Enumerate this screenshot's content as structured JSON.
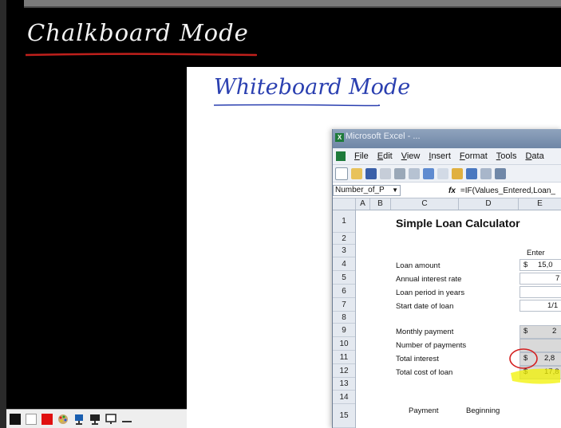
{
  "chalkboard": {
    "title": "Chalkboard Mode",
    "underline_color": "#c0201c"
  },
  "whiteboard": {
    "title": "Whiteboard Mode",
    "ink_color": "#2a3fb0"
  },
  "toolbar": {
    "buttons": [
      {
        "name": "black-color-swatch-icon",
        "color": "#111111"
      },
      {
        "name": "white-color-swatch-icon",
        "color": "#ffffff"
      },
      {
        "name": "red-color-swatch-icon",
        "color": "#e01010"
      },
      {
        "name": "color-palette-icon",
        "color": "#3a7bd5"
      },
      {
        "name": "presenter-icon",
        "color": "#333333"
      },
      {
        "name": "monitor-icon",
        "color": "#333333"
      },
      {
        "name": "minimize-icon",
        "color": "#333333"
      }
    ]
  },
  "excel": {
    "window_title": "Microsoft Excel - ...",
    "menu": [
      "File",
      "Edit",
      "View",
      "Insert",
      "Format",
      "Tools",
      "Data"
    ],
    "name_box": "Number_of_P",
    "fx": "fx",
    "formula": "=IF(Values_Entered,Loan_",
    "columns": [
      "A",
      "B",
      "C",
      "D",
      "E"
    ],
    "rows": [
      "1",
      "2",
      "3",
      "4",
      "5",
      "6",
      "7",
      "8",
      "9",
      "10",
      "11",
      "12",
      "13",
      "14",
      "15"
    ],
    "sheet": {
      "title": "Simple Loan Calculator",
      "enter_header": "Enter",
      "labels": {
        "loan_amount": "Loan amount",
        "annual_rate": "Annual interest rate",
        "loan_period": "Loan period in years",
        "start_date": "Start date of loan",
        "monthly_payment": "Monthly payment",
        "num_payments": "Number of payments",
        "total_interest": "Total interest",
        "total_cost": "Total cost of loan"
      },
      "values": {
        "loan_amount_dollar": "$",
        "loan_amount": "15,0",
        "annual_rate": "7",
        "start_date": "1/1",
        "monthly_payment_dollar": "$",
        "monthly_payment": "2",
        "total_interest_dollar": "$",
        "total_interest": "2,8",
        "total_cost_dollar": "$",
        "total_cost": "17,8"
      },
      "footer": {
        "payment": "Payment",
        "beginning": "Beginning"
      }
    },
    "annotations": {
      "circle_color": "#d42020",
      "highlight_color": "#f2f200"
    }
  }
}
